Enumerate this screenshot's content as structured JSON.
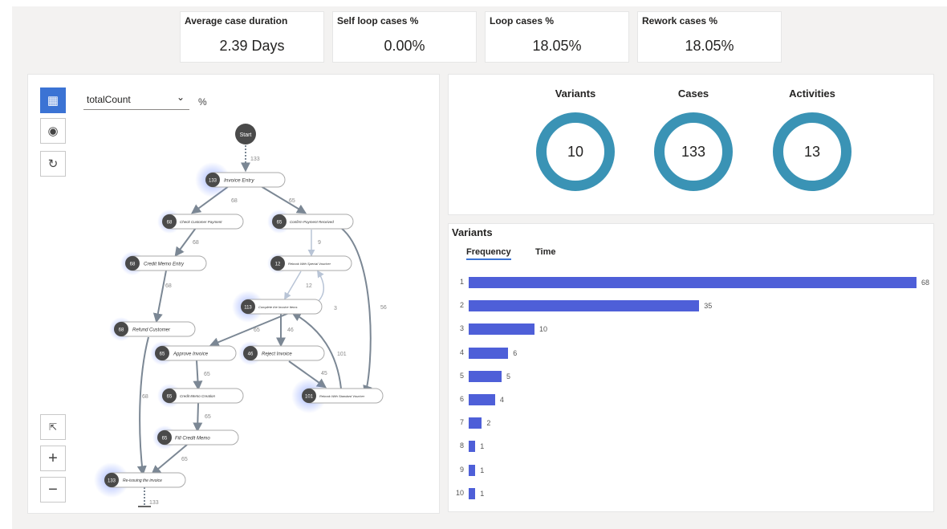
{
  "kpis": [
    {
      "title": "Average case duration",
      "value": "2.39 Days"
    },
    {
      "title": "Self loop cases %",
      "value": "0.00%"
    },
    {
      "title": "Loop cases %",
      "value": "18.05%"
    },
    {
      "title": "Rework cases %",
      "value": "18.05%"
    }
  ],
  "map_controls": {
    "measure_select": "totalCount",
    "percent_toggle": "%",
    "tool_icons": [
      "clipboard-icon",
      "disc-icon",
      "refresh-icon"
    ],
    "zoom_icons": [
      "fit-screen-icon",
      "zoom-in-icon",
      "zoom-out-icon"
    ],
    "zoom_in": "+",
    "zoom_out": "−"
  },
  "process_map": {
    "start_label": "Start",
    "end_count": "133",
    "nodes": [
      {
        "id": "n1",
        "count": "133",
        "label": "Invoice Entry"
      },
      {
        "id": "n2",
        "count": "68",
        "label": "Check Customer Payment"
      },
      {
        "id": "n3",
        "count": "65",
        "label": "Confirm Payment Received"
      },
      {
        "id": "n4",
        "count": "68",
        "label": "Credit Memo Entry"
      },
      {
        "id": "n5",
        "count": "12",
        "label": "Rebook With Special Voucher"
      },
      {
        "id": "n6",
        "count": "113",
        "label": "Complete the Invoice Items"
      },
      {
        "id": "n7",
        "count": "68",
        "label": "Refund Customer"
      },
      {
        "id": "n8",
        "count": "65",
        "label": "Approve Invoice"
      },
      {
        "id": "n9",
        "count": "46",
        "label": "Reject Invoice"
      },
      {
        "id": "n10",
        "count": "65",
        "label": "Credit Memo Creation"
      },
      {
        "id": "n11",
        "count": "101",
        "label": "Rebook With Standard Voucher"
      },
      {
        "id": "n12",
        "count": "65",
        "label": "Fill Credit Memo"
      },
      {
        "id": "n13",
        "count": "133",
        "label": "Re-issuing the invoice"
      }
    ],
    "edges": [
      {
        "id": "e0",
        "label": "133"
      },
      {
        "id": "e1",
        "label": "68"
      },
      {
        "id": "e2",
        "label": "65"
      },
      {
        "id": "e3",
        "label": "68"
      },
      {
        "id": "e4",
        "label": "9"
      },
      {
        "id": "e5",
        "label": "68"
      },
      {
        "id": "e6",
        "label": "12"
      },
      {
        "id": "e7",
        "label": "56"
      },
      {
        "id": "e8",
        "label": "3"
      },
      {
        "id": "e9",
        "label": "65"
      },
      {
        "id": "e10",
        "label": "46"
      },
      {
        "id": "e11",
        "label": "101"
      },
      {
        "id": "e12",
        "label": "65"
      },
      {
        "id": "e13",
        "label": "45"
      },
      {
        "id": "e14",
        "label": "68"
      },
      {
        "id": "e15",
        "label": "65"
      },
      {
        "id": "e16",
        "label": "65"
      }
    ]
  },
  "metrics": [
    {
      "label": "Variants",
      "value": "10"
    },
    {
      "label": "Cases",
      "value": "133"
    },
    {
      "label": "Activities",
      "value": "13"
    }
  ],
  "variants_panel": {
    "title": "Variants",
    "tabs": [
      "Frequency",
      "Time"
    ],
    "bar_color": "#4e5fd8"
  },
  "chart_data": {
    "type": "bar",
    "orientation": "horizontal",
    "categories": [
      "1",
      "2",
      "3",
      "4",
      "5",
      "6",
      "7",
      "8",
      "9",
      "10"
    ],
    "values": [
      68,
      35,
      10,
      6,
      5,
      4,
      2,
      1,
      1,
      1
    ],
    "xlim": [
      0,
      68
    ]
  },
  "colors": {
    "accent": "#3b73d4",
    "donut": "#3a93b5",
    "bar": "#4e5fd8",
    "node": "#4a4a4a"
  }
}
